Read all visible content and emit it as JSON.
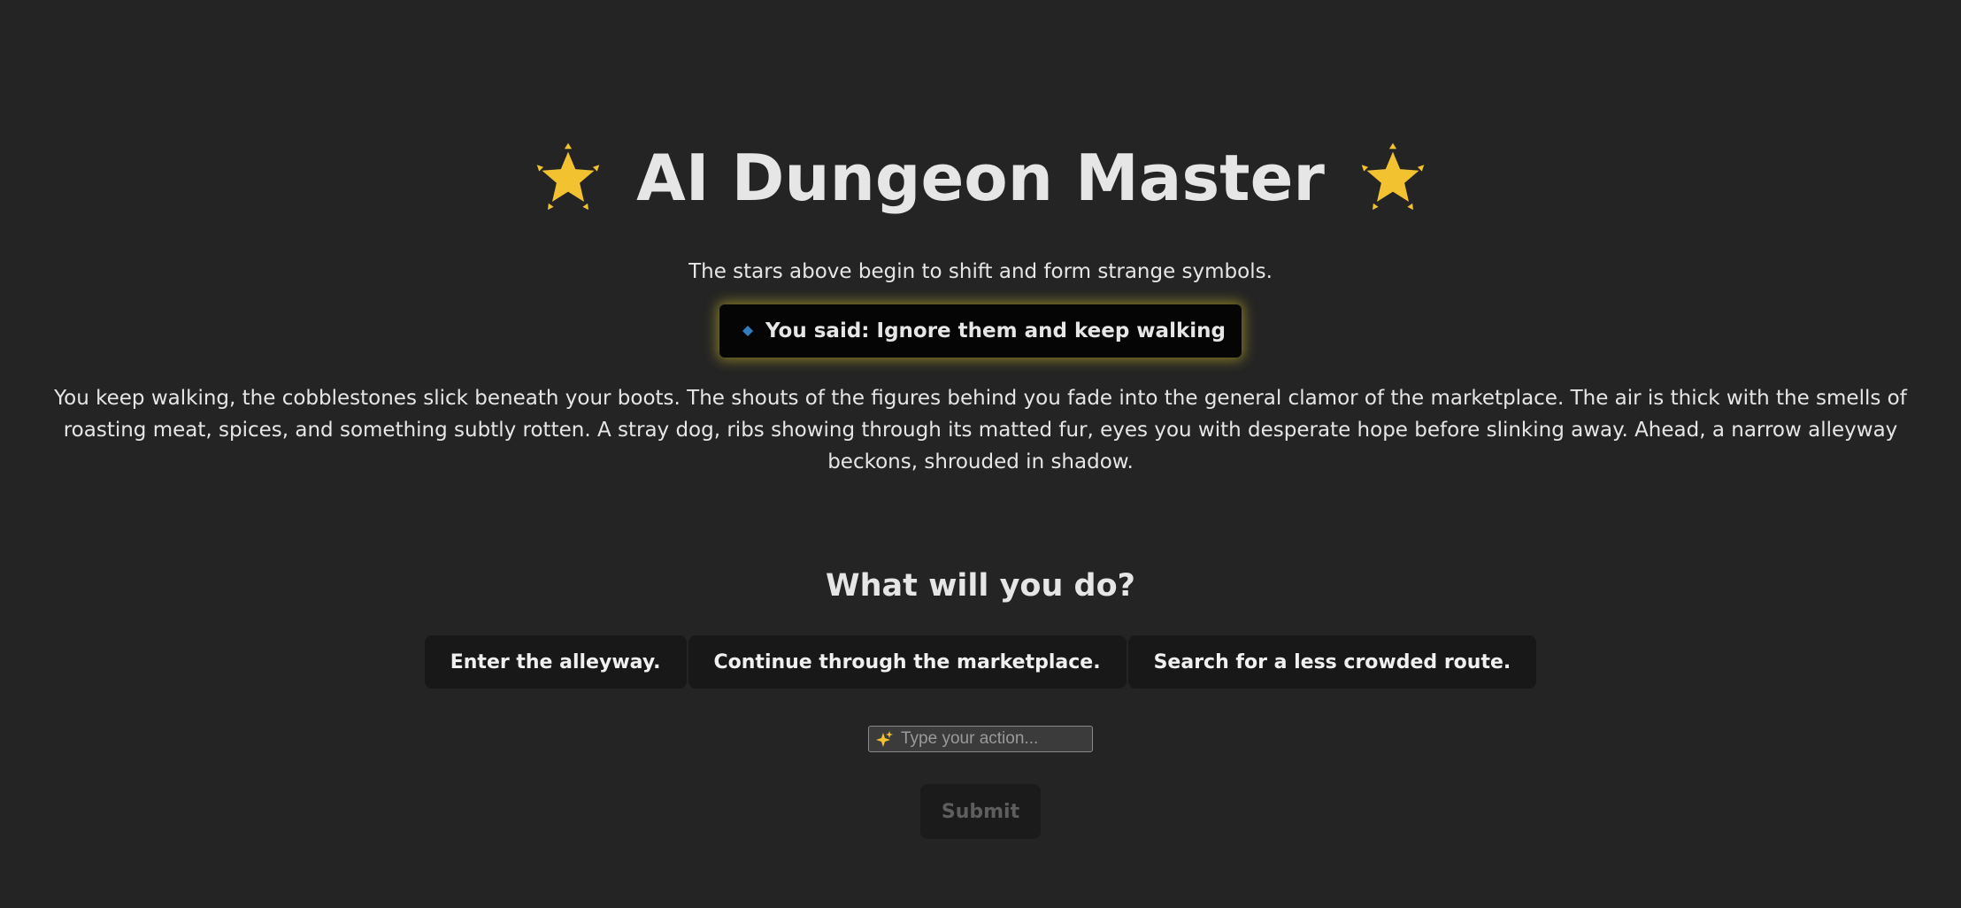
{
  "header": {
    "title": "AI Dungeon Master",
    "left_icon": "glowing-star-icon",
    "right_icon": "glowing-star-icon"
  },
  "narration": {
    "intro": "The stars above begin to shift and form strange symbols.",
    "you_said": "You said: Ignore them and keep walking",
    "you_said_icon": "blue-diamond-icon",
    "story": "You keep walking, the cobblestones slick beneath your boots. The shouts of the figures behind you fade into the general clamor of the marketplace. The air is thick with the smells of roasting meat, spices, and something subtly rotten. A stray dog, ribs showing through its matted fur, eyes you with desperate hope before slinking away. Ahead, a narrow alleyway beckons, shrouded in shadow."
  },
  "actions": {
    "prompt": "What will you do?",
    "choices": [
      "Enter the alleyway.",
      "Continue through the marketplace.",
      "Search for a less crowded route."
    ],
    "input_placeholder": "Type your action...",
    "input_icon": "sparkles-icon",
    "submit_label": "Submit"
  },
  "colors": {
    "background": "#242424",
    "star": "#F2C230",
    "glow": "#D2BE28",
    "diamond": "#2F7FC1"
  }
}
